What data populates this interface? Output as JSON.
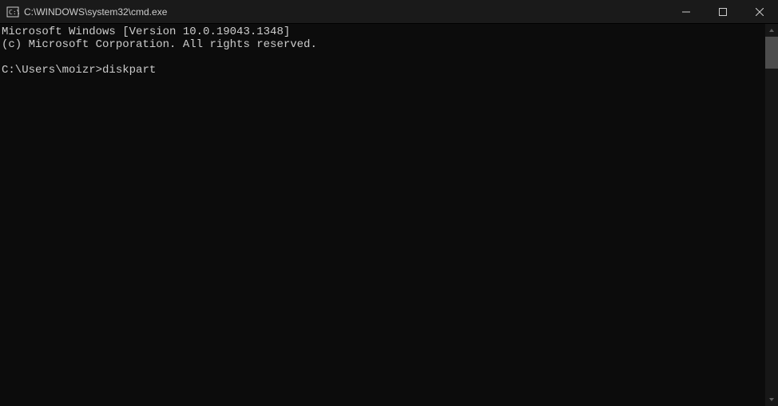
{
  "titlebar": {
    "title": "C:\\WINDOWS\\system32\\cmd.exe"
  },
  "terminal": {
    "line1": "Microsoft Windows [Version 10.0.19043.1348]",
    "line2": "(c) Microsoft Corporation. All rights reserved.",
    "blank": "",
    "prompt": "C:\\Users\\moizr>",
    "command": "diskpart"
  }
}
